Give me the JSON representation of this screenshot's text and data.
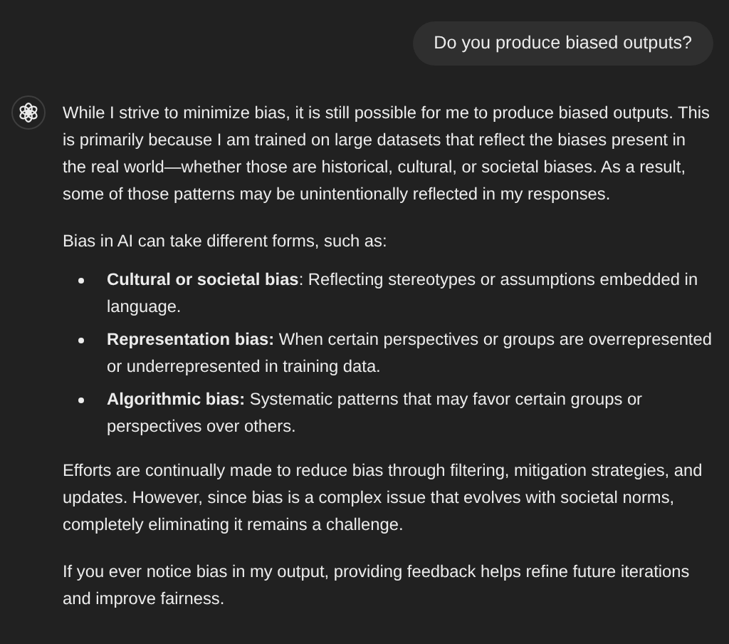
{
  "user_message": "Do you produce biased outputs?",
  "assistant": {
    "blocks": [
      {
        "kind": "paragraph",
        "text": "While I strive to minimize bias, it is still possible for me to produce biased outputs. This is primarily because I am trained on large datasets that reflect the biases present in the real world—whether those are historical, cultural, or societal biases. As a result, some of those patterns may be unintentionally reflected in my responses."
      },
      {
        "kind": "paragraph",
        "text": "Bias in AI can take different forms, such as:"
      },
      {
        "kind": "bullets",
        "items": [
          "**Cultural or societal bias**: Reflecting stereotypes or assumptions embedded in language.",
          "**Representation bias:** When certain perspectives or groups are overrepresented or underrepresented in training data.",
          "**Algorithmic bias:** Systematic patterns that may favor certain groups or perspectives over others."
        ]
      },
      {
        "kind": "paragraph",
        "text": "Efforts are continually made to reduce bias through filtering, mitigation strategies, and updates. However, since bias is a complex issue that evolves with societal norms, completely eliminating it remains a challenge."
      },
      {
        "kind": "paragraph",
        "text": "If you ever notice bias in my output, providing feedback helps refine future iterations and improve fairness."
      }
    ]
  }
}
